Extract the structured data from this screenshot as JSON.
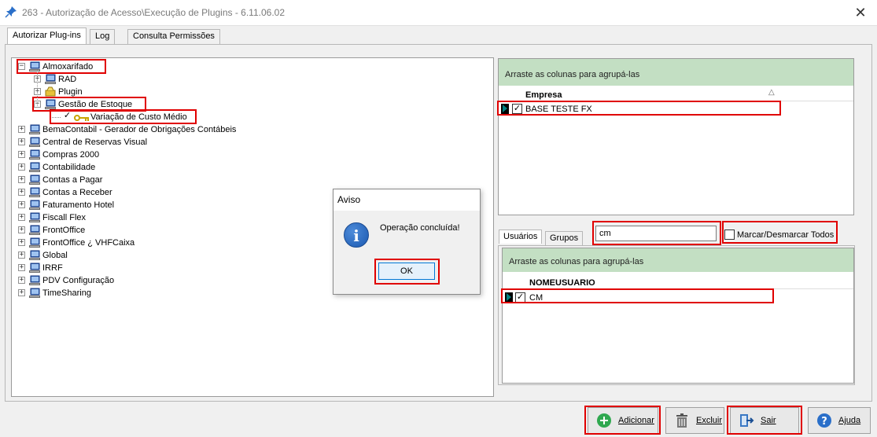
{
  "window": {
    "title": "263 - Autorização de Acesso\\Execução de Plugins - 6.11.06.02",
    "close_symbol": "✕"
  },
  "tabs": [
    "Autorizar Plug-ins",
    "Log",
    "Consulta Permissões"
  ],
  "tree": {
    "items": [
      {
        "label": "Almoxarifado",
        "level": 0,
        "expanded": true,
        "highlighted": true
      },
      {
        "label": "RAD",
        "level": 1,
        "expanded": false
      },
      {
        "label": "Plugin",
        "level": 1,
        "expanded": false
      },
      {
        "label": "Gestão de Estoque",
        "level": 1,
        "expanded": true,
        "highlighted": true
      },
      {
        "label": "Variação de Custo Médio",
        "level": 2,
        "checked": true,
        "highlighted": true
      },
      {
        "label": "BemaContabil - Gerador de Obrigações Contábeis",
        "level": 0,
        "expanded": false
      },
      {
        "label": "Central de Reservas Visual",
        "level": 0,
        "expanded": false
      },
      {
        "label": "Compras 2000",
        "level": 0,
        "expanded": false
      },
      {
        "label": "Contabilidade",
        "level": 0,
        "expanded": false
      },
      {
        "label": "Contas a Pagar",
        "level": 0,
        "expanded": false
      },
      {
        "label": "Contas a Receber",
        "level": 0,
        "expanded": false
      },
      {
        "label": "Faturamento Hotel",
        "level": 0,
        "expanded": false
      },
      {
        "label": "Fiscall Flex",
        "level": 0,
        "expanded": false
      },
      {
        "label": "FrontOffice",
        "level": 0,
        "expanded": false
      },
      {
        "label": "FrontOffice ¿ VHFCaixa",
        "level": 0,
        "expanded": false
      },
      {
        "label": "Global",
        "level": 0,
        "expanded": false
      },
      {
        "label": "IRRF",
        "level": 0,
        "expanded": false
      },
      {
        "label": "PDV Configuração",
        "level": 0,
        "expanded": false
      },
      {
        "label": "TimeSharing",
        "level": 0,
        "expanded": false
      }
    ]
  },
  "empresa_grid": {
    "group_panel": "Arraste as colunas para agrupá-las",
    "column": "Empresa",
    "sort_symbol": "△",
    "rows": [
      {
        "value": "BASE TESTE FX",
        "checked": true
      }
    ]
  },
  "lower_tabs": [
    "Usuários",
    "Grupos"
  ],
  "search": {
    "value": "cm"
  },
  "mark_all": {
    "label": "Marcar/Desmarcar Todos",
    "checked": false
  },
  "usuarios_grid": {
    "group_panel": "Arraste as colunas para agrupá-las",
    "column": "NOMEUSUARIO",
    "rows": [
      {
        "value": "CM",
        "checked": true
      }
    ]
  },
  "dialog": {
    "title": "Aviso",
    "message": "Operação concluída!",
    "ok": "OK",
    "icon_glyph": "i"
  },
  "buttons": {
    "adicionar": "Adicionar",
    "excluir": "Excluir",
    "sair": "Sair",
    "ajuda": "Ajuda"
  },
  "colors": {
    "highlight": "#e00000",
    "group_panel": "#c3dfc3",
    "accent": "#0078d7"
  }
}
